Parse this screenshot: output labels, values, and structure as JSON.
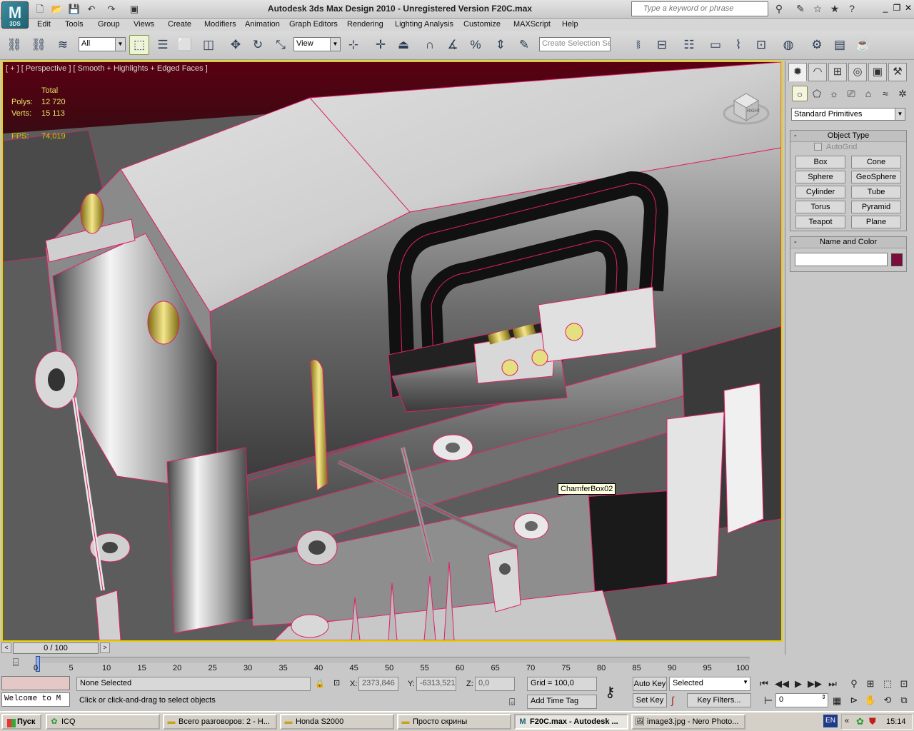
{
  "title_bar": {
    "title": "Autodesk 3ds Max Design 2010  - Unregistered Version     F20C.max",
    "search_placeholder": "Type a keyword or phrase",
    "logo_label": "3DS"
  },
  "menu": [
    "Edit",
    "Tools",
    "Group",
    "Views",
    "Create",
    "Modifiers",
    "Animation",
    "Graph Editors",
    "Rendering",
    "Lighting Analysis",
    "Customize",
    "MAXScript",
    "Help"
  ],
  "toolbar": {
    "selection_filter": "All",
    "reference_coord": "View",
    "selection_set_placeholder": "Create Selection Se"
  },
  "viewport": {
    "label": "[ + ] [ Perspective ] [ Smooth + Highlights + Edged Faces ]",
    "stats": {
      "header": "Total",
      "polys_label": "Polys:",
      "polys_value": "12 720",
      "verts_label": "Verts:",
      "verts_value": "15 113",
      "fps_label": "FPS:",
      "fps_value": "74,019"
    },
    "tooltip": "ChamferBox02",
    "viewcube_face": "RIGHT"
  },
  "command_panel": {
    "category": "Standard Primitives",
    "object_type_title": "Object Type",
    "autogrid_label": "AutoGrid",
    "primitives": [
      "Box",
      "Cone",
      "Sphere",
      "GeoSphere",
      "Cylinder",
      "Tube",
      "Torus",
      "Pyramid",
      "Teapot",
      "Plane"
    ],
    "name_color_title": "Name and Color",
    "object_name": "",
    "object_color": "#7a0d3c"
  },
  "time_slider": {
    "position_label": "0 / 100",
    "ticks": [
      "0",
      "5",
      "10",
      "15",
      "20",
      "25",
      "30",
      "35",
      "40",
      "45",
      "50",
      "55",
      "60",
      "65",
      "70",
      "75",
      "80",
      "85",
      "90",
      "95",
      "100"
    ]
  },
  "status": {
    "selection": "None Selected",
    "prompt": "Click or click-and-drag to select objects",
    "welcome": "Welcome to M",
    "x_label": "X:",
    "x_value": "2373,846",
    "y_label": "Y:",
    "y_value": "-6313,521",
    "z_label": "Z:",
    "z_value": "0,0",
    "grid": "Grid = 100,0",
    "add_time_tag": "Add Time Tag",
    "auto_key": "Auto Key",
    "set_key": "Set Key",
    "key_mode": "Selected",
    "key_filters": "Key Filters...",
    "current_frame": "0"
  },
  "taskbar": {
    "start": "Пуск",
    "tasks": [
      {
        "label": "ICQ",
        "icon": "icq-flower-icon"
      },
      {
        "label": "Всего разговоров: 2 - Н...",
        "icon": "folder-icon"
      },
      {
        "label": "Honda S2000",
        "icon": "folder-icon"
      },
      {
        "label": "Просто скрины",
        "icon": "folder-icon"
      },
      {
        "label": "F20C.max - Autodesk ...",
        "icon": "3dsmax-icon"
      },
      {
        "label": "image3.jpg - Nero Photo...",
        "icon": "image-viewer-icon"
      }
    ],
    "language": "EN",
    "clock": "15:14"
  },
  "colors": {
    "viewport_border": "#e8d000",
    "stats_text": "#e8e060",
    "wireframe_edge": "#e0206a",
    "object_color": "#7a0d3c"
  }
}
